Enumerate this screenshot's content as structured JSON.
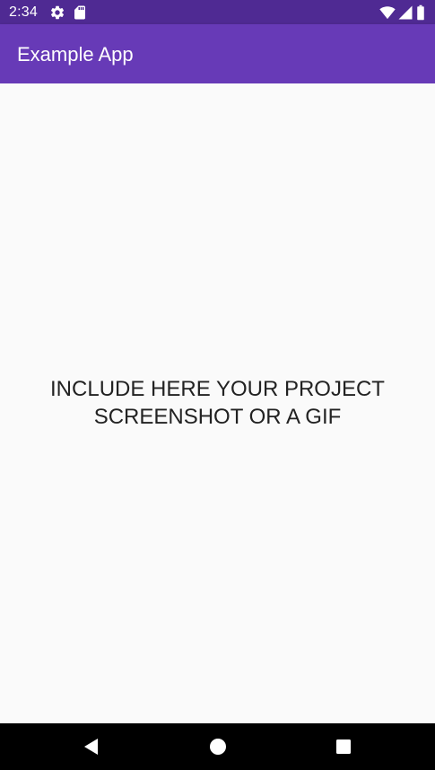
{
  "status_bar": {
    "time": "2:34",
    "icons_left": [
      "gear-icon",
      "sd-card-icon"
    ],
    "icons_right": [
      "wifi-icon",
      "signal-icon",
      "battery-icon"
    ],
    "background": "#4f2a93"
  },
  "app_bar": {
    "title": "Example App",
    "background": "#673ab7"
  },
  "content": {
    "message_line_1": "INCLUDE HERE YOUR PROJECT",
    "message_line_2": "SCREENSHOT OR A GIF",
    "background": "#fafafa"
  },
  "nav_bar": {
    "buttons": [
      "back-icon",
      "home-icon",
      "recents-icon"
    ],
    "background": "#000000"
  }
}
